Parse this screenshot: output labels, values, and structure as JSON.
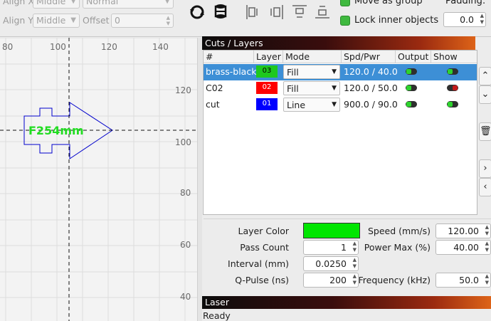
{
  "toolbar": {
    "align_x_label": "Align X",
    "align_x_value": "Middle",
    "align_x_mode": "Normal",
    "align_y_label": "Align Y",
    "align_y_value": "Middle",
    "offset_label": "Offset",
    "offset_value": "0",
    "move_as_group": "Move as group",
    "lock_inner": "Lock inner objects",
    "padding_label": "Padding:",
    "padding_value": "0.0"
  },
  "canvas": {
    "x_ticks": [
      "80",
      "100",
      "120",
      "140"
    ],
    "y_ticks": [
      "120",
      "100",
      "80",
      "60",
      "40"
    ],
    "shape_label": "F254mm",
    "shape_label_color": "#22dd22",
    "shape_stroke": "#0000cc"
  },
  "cuts": {
    "title": "Cuts / Layers",
    "columns": [
      "#",
      "Layer",
      "Mode",
      "Spd/Pwr",
      "Output",
      "Show"
    ],
    "rows": [
      {
        "name": "brass-black",
        "layer": "03",
        "color": "#1ec81e",
        "mode": "Fill",
        "spdpwr": "120.0 / 40.0",
        "output": "on",
        "show": "on",
        "selected": true
      },
      {
        "name": "C02",
        "layer": "02",
        "color": "#ff0000",
        "mode": "Fill",
        "spdpwr": "120.0 / 50.0",
        "output": "on",
        "show": "off",
        "selected": false
      },
      {
        "name": "cut",
        "layer": "01",
        "color": "#0000ff",
        "mode": "Line",
        "spdpwr": "900.0 / 90.0",
        "output": "on",
        "show": "on",
        "selected": false
      }
    ]
  },
  "side_buttons": [
    "up-icon",
    "down-icon",
    "trash-icon",
    "right-icon",
    "left-icon"
  ],
  "props": {
    "layer_color_label": "Layer Color",
    "layer_color": "#00e600",
    "pass_count_label": "Pass Count",
    "pass_count": "1",
    "interval_label": "Interval (mm)",
    "interval": "0.0250",
    "qpulse_label": "Q-Pulse (ns)",
    "qpulse": "200",
    "speed_label": "Speed (mm/s)",
    "speed": "120.00",
    "power_label": "Power Max (%)",
    "power": "40.00",
    "freq_label": "Frequency (kHz)",
    "freq": "50.0"
  },
  "laser": {
    "title": "Laser",
    "status": "Ready"
  }
}
